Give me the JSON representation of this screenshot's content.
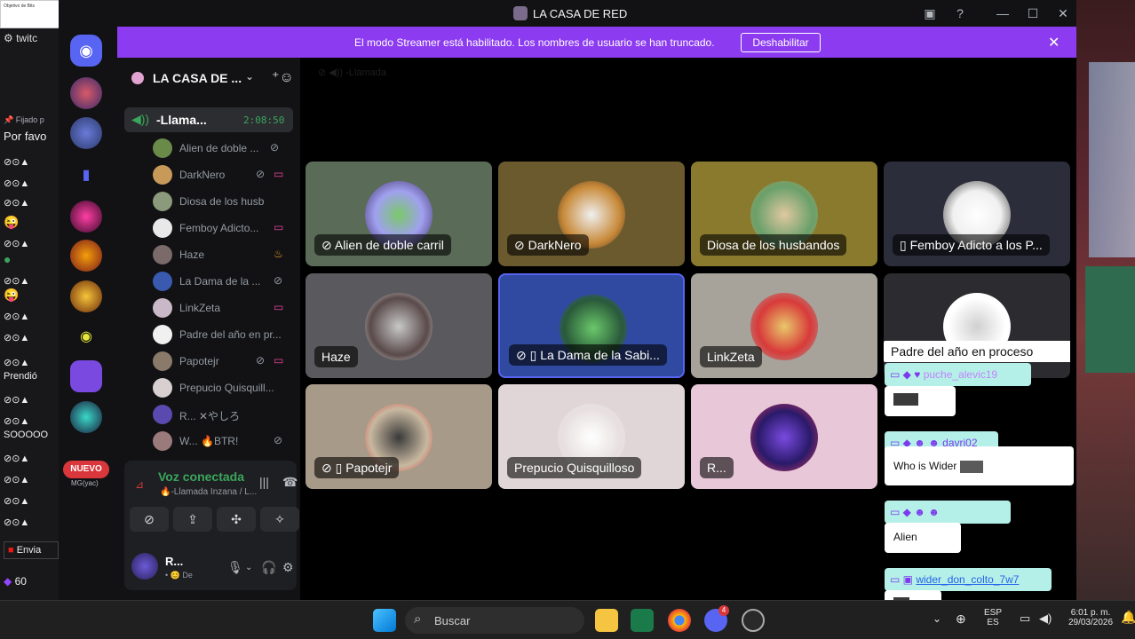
{
  "twitch": {
    "tab_label": "twitc",
    "mini_title": "Objetivo de Bits",
    "pinned_label": "Fijado p",
    "pinned_text": "Por favo",
    "prendio": "Prendió",
    "soooo": "SOOOOO",
    "send_label": "Envia",
    "bits_count": "60"
  },
  "window": {
    "title": "LA CASA DE RED"
  },
  "streamer_bar": {
    "message": "El modo Streamer está habilitado. Los nombres de usuario se han truncado.",
    "disable_button": "Deshabilitar"
  },
  "rail": {
    "new_badge": "NUEVO",
    "new_sub": "MG(yac)"
  },
  "sidebar": {
    "server_name": "LA CASA DE ...",
    "voice_channel": {
      "name": "-Llama...",
      "timer": "2:08:50"
    },
    "members": [
      {
        "name": "Alien de doble ...",
        "icons": [
          "deafened-icon"
        ]
      },
      {
        "name": "DarkNero",
        "icons": [
          "deafened-icon",
          "nitro-icon"
        ]
      },
      {
        "name": "Diosa de los husba...",
        "icons": []
      },
      {
        "name": "Femboy Adicto...",
        "icons": [
          "nitro-icon"
        ]
      },
      {
        "name": "Haze",
        "icons": [
          "fire-icon"
        ]
      },
      {
        "name": "La Dama de la ...",
        "icons": [
          "deafened-icon"
        ]
      },
      {
        "name": "LinkZeta",
        "icons": [
          "nitro-icon"
        ]
      },
      {
        "name": "Padre del año en pr...",
        "icons": []
      },
      {
        "name": "Papotejr",
        "icons": [
          "deafened-icon",
          "nitro-icon"
        ]
      },
      {
        "name": "Prepucio Quisquill...",
        "icons": []
      },
      {
        "name": "R... ✕やしろ",
        "icons": []
      },
      {
        "name": "W... 🔥BTR!",
        "icons": [
          "deafened-icon"
        ]
      }
    ],
    "voice_panel": {
      "status": "Voz conectada",
      "channel": "🔥-Llamada Inzana / L..."
    },
    "user": {
      "name": "R...",
      "status": "• 😊 De"
    }
  },
  "tiles": [
    {
      "name": "Alien de doble carril",
      "icons": "deafened",
      "bg": "#5a6b58"
    },
    {
      "name": "DarkNero",
      "icons": "deafened",
      "bg": "#6b5a2e"
    },
    {
      "name": "Diosa de los husbandos",
      "icons": "",
      "bg": "#8a7a2e"
    },
    {
      "name": "Femboy Adicto a los P...",
      "icons": "phone",
      "bg": "#2b2d3a"
    },
    {
      "name": "Haze",
      "icons": "",
      "bg": "#5a5a5e"
    },
    {
      "name": "La Dama de la Sabi...",
      "icons": "deafened-phone",
      "bg": "#2f4aa0"
    },
    {
      "name": "LinkZeta",
      "icons": "",
      "bg": "#a8a39a"
    },
    {
      "name": "Padre del año en proceso",
      "icons": "",
      "bg": "#2b2b30"
    },
    {
      "name": "Papotejr",
      "icons": "deafened-phone",
      "bg": "#a89a88"
    },
    {
      "name": "Prepucio Quisquilloso",
      "icons": "",
      "bg": "#e0d6d8"
    },
    {
      "name": "R...",
      "icons": "",
      "bg": "#e8c8d8"
    }
  ],
  "chat": [
    {
      "user": "puche_alevic19",
      "text": "",
      "color": "#b5f0e8",
      "user_color": "#c084fc"
    },
    {
      "user": "davri02",
      "text": "Who is Wider",
      "color": "#b5f0e8",
      "user_color": "#7c3aed"
    },
    {
      "user": "",
      "text": "Alien",
      "color": "#b5f0e8",
      "user_color": "#16a34a"
    },
    {
      "user": "wider_don_colto_7w7",
      "text": "",
      "color": "#b5f0e8",
      "user_color": "#2563eb"
    }
  ],
  "taskbar": {
    "search_label": "Buscar",
    "lang_top": "ESP",
    "lang_bottom": "ES",
    "time": "6:01 p. m.",
    "date": "29/03/2026",
    "discord_badge": "4"
  }
}
